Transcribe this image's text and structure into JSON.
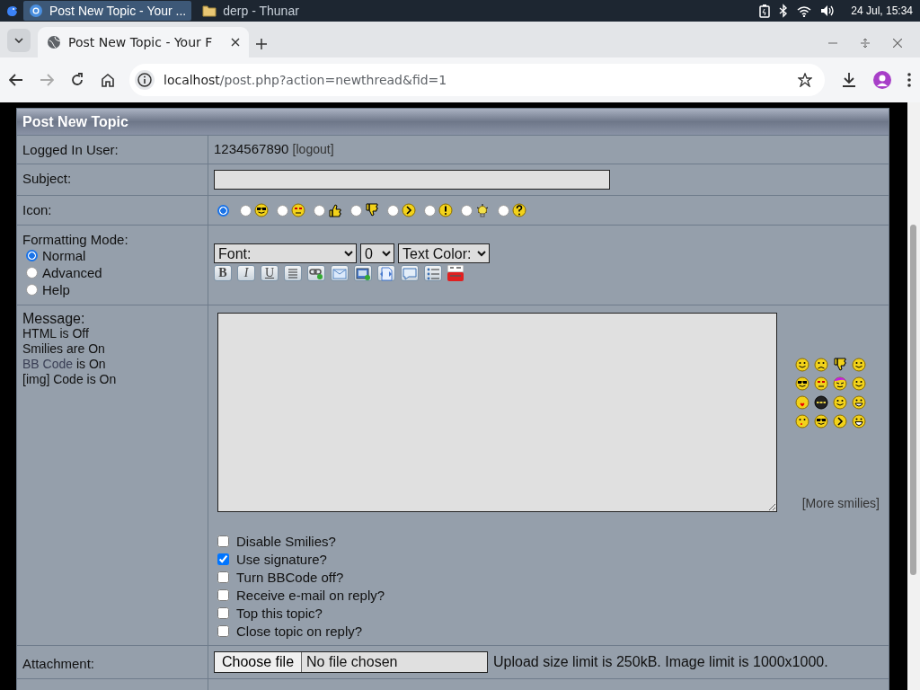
{
  "taskbar": {
    "windows": [
      {
        "title": "Post New Topic - Your ...",
        "selected": true
      },
      {
        "title": "derp - Thunar",
        "selected": false
      }
    ],
    "clock": "24 Jul, 15:34"
  },
  "browser": {
    "tab_title": "Post New Topic - Your F",
    "url_host": "localhost",
    "url_path": "/post.php?action=newthread&fid=1"
  },
  "form": {
    "title": "Post New Topic",
    "logged_in": {
      "label": "Logged In User:",
      "user": "1234567890",
      "logout": "[logout]"
    },
    "subject": {
      "label": "Subject:"
    },
    "icon": {
      "label": "Icon:",
      "options": [
        {
          "selected": true
        },
        {
          "selected": false
        },
        {
          "selected": false
        },
        {
          "selected": false
        },
        {
          "selected": false
        },
        {
          "selected": false
        },
        {
          "selected": false
        },
        {
          "selected": false
        },
        {
          "selected": false
        }
      ]
    },
    "formatting": {
      "label": "Formatting Mode:",
      "modes": [
        {
          "label": "Normal",
          "selected": true
        },
        {
          "label": "Advanced",
          "selected": false
        },
        {
          "label": "Help",
          "selected": false
        }
      ],
      "font": "Font:",
      "size": "0",
      "color_menu": "Text Color:",
      "style_buttons": [
        "B",
        "I",
        "U"
      ]
    },
    "message": {
      "label": "Message:",
      "notes": [
        {
          "text": "HTML is Off"
        },
        {
          "text": "Smilies are On"
        },
        {
          "link": "BB Code",
          "text": "is On"
        },
        {
          "text": "[img] Code is On"
        }
      ],
      "more_smilies": "[More smilies]"
    },
    "options": [
      {
        "label": "Disable Smilies?",
        "checked": false
      },
      {
        "label": "Use signature?",
        "checked": true
      },
      {
        "label": "Turn BBCode off?",
        "checked": false
      },
      {
        "label": "Receive e-mail on reply?",
        "checked": false
      },
      {
        "label": "Top this topic?",
        "checked": false
      },
      {
        "label": "Close topic on reply?",
        "checked": false
      }
    ],
    "attachment": {
      "label": "Attachment:",
      "button": "Choose file",
      "file": "No file chosen",
      "note": "Upload size limit is 250kB. Image limit is 1000x1000."
    }
  }
}
